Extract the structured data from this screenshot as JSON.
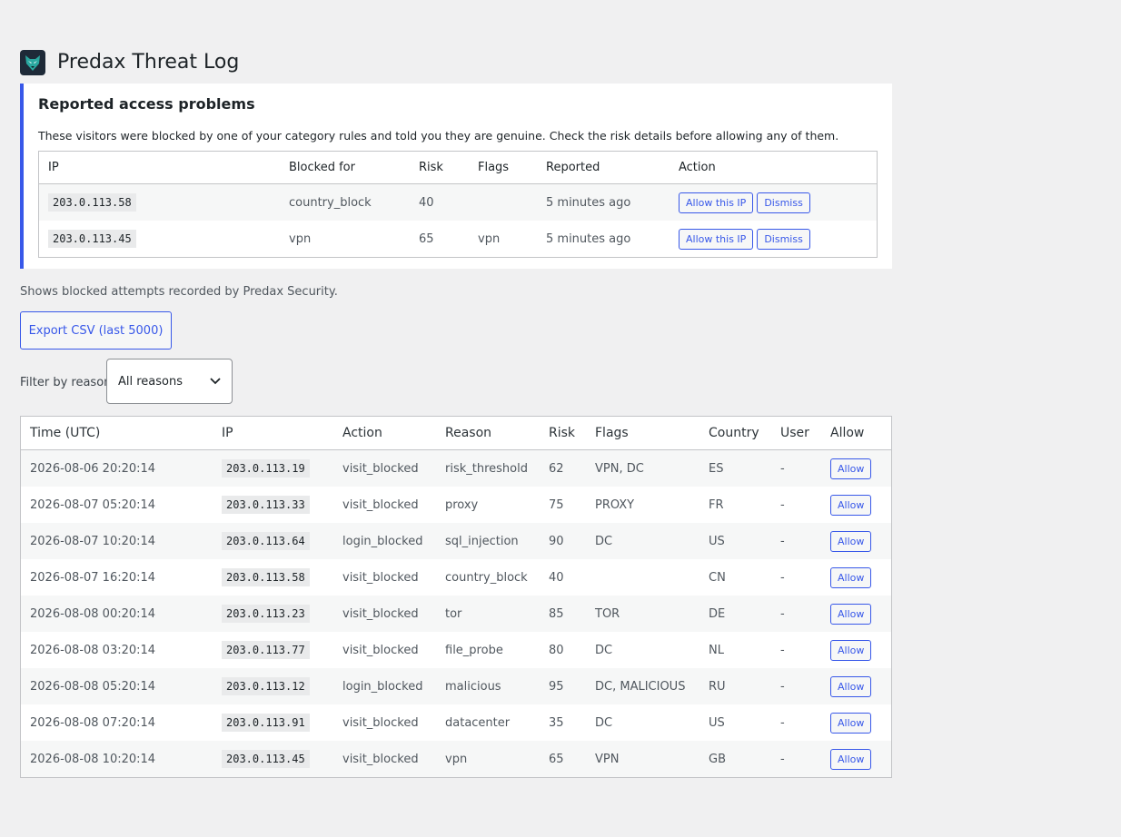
{
  "header": {
    "title": "Predax Threat Log",
    "logo_icon": "wolf-logo-icon"
  },
  "notice": {
    "title": "Reported access problems",
    "description": "These visitors were blocked by one of your category rules and told you they are genuine. Check the risk details before allowing any of them.",
    "columns": [
      "IP",
      "Blocked for",
      "Risk",
      "Flags",
      "Reported",
      "Action"
    ],
    "rows": [
      {
        "ip": "203.0.113.58",
        "blocked_for": "country_block",
        "risk": "40",
        "flags": "",
        "reported": "5 minutes ago",
        "allow_label": "Allow this IP",
        "dismiss_label": "Dismiss"
      },
      {
        "ip": "203.0.113.45",
        "blocked_for": "vpn",
        "risk": "65",
        "flags": "vpn",
        "reported": "5 minutes ago",
        "allow_label": "Allow this IP",
        "dismiss_label": "Dismiss"
      }
    ]
  },
  "intro": "Shows blocked attempts recorded by Predax Security.",
  "export_label": "Export CSV (last 5000)",
  "filter": {
    "label": "Filter by reason:",
    "selected": "All reasons"
  },
  "log": {
    "columns": [
      "Time (UTC)",
      "IP",
      "Action",
      "Reason",
      "Risk",
      "Flags",
      "Country",
      "User",
      "Allow"
    ],
    "rows": [
      {
        "time": "2026-08-06 20:20:14",
        "ip": "203.0.113.19",
        "action": "visit_blocked",
        "reason": "risk_threshold",
        "risk": "62",
        "flags": "VPN, DC",
        "country": "ES",
        "user": "-",
        "allow": "Allow"
      },
      {
        "time": "2026-08-07 05:20:14",
        "ip": "203.0.113.33",
        "action": "visit_blocked",
        "reason": "proxy",
        "risk": "75",
        "flags": "PROXY",
        "country": "FR",
        "user": "-",
        "allow": "Allow"
      },
      {
        "time": "2026-08-07 10:20:14",
        "ip": "203.0.113.64",
        "action": "login_blocked",
        "reason": "sql_injection",
        "risk": "90",
        "flags": "DC",
        "country": "US",
        "user": "-",
        "allow": "Allow"
      },
      {
        "time": "2026-08-07 16:20:14",
        "ip": "203.0.113.58",
        "action": "visit_blocked",
        "reason": "country_block",
        "risk": "40",
        "flags": "",
        "country": "CN",
        "user": "-",
        "allow": "Allow"
      },
      {
        "time": "2026-08-08 00:20:14",
        "ip": "203.0.113.23",
        "action": "visit_blocked",
        "reason": "tor",
        "risk": "85",
        "flags": "TOR",
        "country": "DE",
        "user": "-",
        "allow": "Allow"
      },
      {
        "time": "2026-08-08 03:20:14",
        "ip": "203.0.113.77",
        "action": "visit_blocked",
        "reason": "file_probe",
        "risk": "80",
        "flags": "DC",
        "country": "NL",
        "user": "-",
        "allow": "Allow"
      },
      {
        "time": "2026-08-08 05:20:14",
        "ip": "203.0.113.12",
        "action": "login_blocked",
        "reason": "malicious",
        "risk": "95",
        "flags": "DC, MALICIOUS",
        "country": "RU",
        "user": "-",
        "allow": "Allow"
      },
      {
        "time": "2026-08-08 07:20:14",
        "ip": "203.0.113.91",
        "action": "visit_blocked",
        "reason": "datacenter",
        "risk": "35",
        "flags": "DC",
        "country": "US",
        "user": "-",
        "allow": "Allow"
      },
      {
        "time": "2026-08-08 10:20:14",
        "ip": "203.0.113.45",
        "action": "visit_blocked",
        "reason": "vpn",
        "risk": "65",
        "flags": "VPN",
        "country": "GB",
        "user": "-",
        "allow": "Allow"
      }
    ]
  },
  "colors": {
    "accent": "#3858e9",
    "background": "#f0f0f1",
    "logo_bg": "#1e2a38"
  }
}
